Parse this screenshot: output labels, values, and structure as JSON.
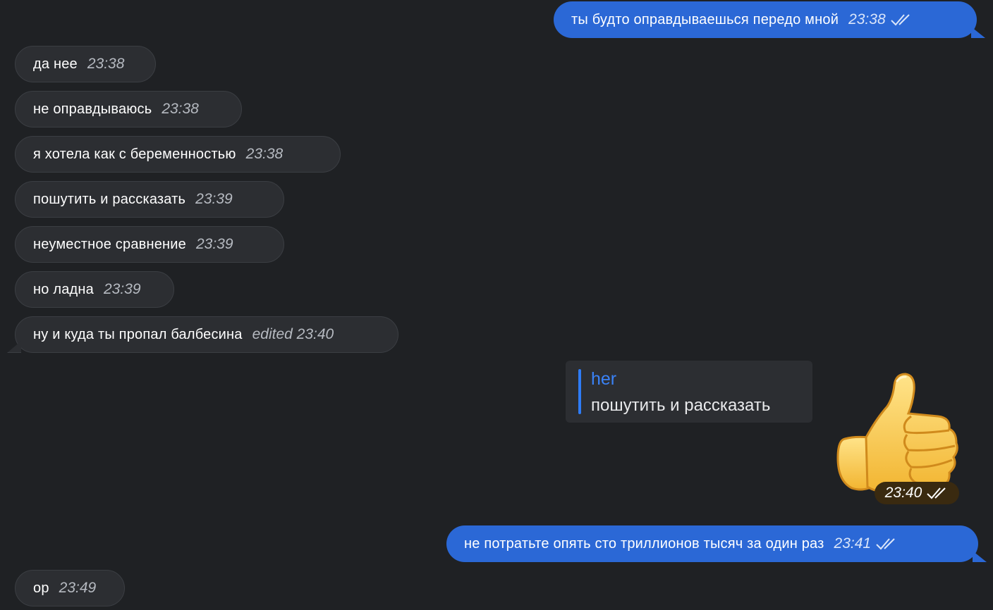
{
  "messages": {
    "m1": {
      "text": "ты будто оправдываешься передо мной",
      "time": "23:38"
    },
    "m2": {
      "text": "да нее",
      "time": "23:38"
    },
    "m3": {
      "text": "не оправдываюсь",
      "time": "23:38"
    },
    "m4": {
      "text": "я хотела как с беременностью",
      "time": "23:38"
    },
    "m5": {
      "text": "пошутить и рассказать",
      "time": "23:39"
    },
    "m6": {
      "text": "неуместное сравнение",
      "time": "23:39"
    },
    "m7": {
      "text": "но ладна",
      "time": "23:39"
    },
    "m8": {
      "text": "ну и куда ты пропал балбесина",
      "time": "edited 23:40"
    },
    "reply": {
      "name": "her",
      "text": "пошутить и рассказать"
    },
    "sticker": {
      "time": "23:40",
      "icon": "thumbs-up-sticker"
    },
    "m9": {
      "text": "не потратьте опять сто триллионов тысяч за один раз",
      "time": "23:41"
    },
    "m10": {
      "text": "ор",
      "time": "23:49"
    }
  },
  "colors": {
    "background": "#1f2124",
    "incoming_bubble": "#2c2e32",
    "outgoing_bubble": "#2b68d6",
    "reply_accent": "#2e7cf6"
  }
}
